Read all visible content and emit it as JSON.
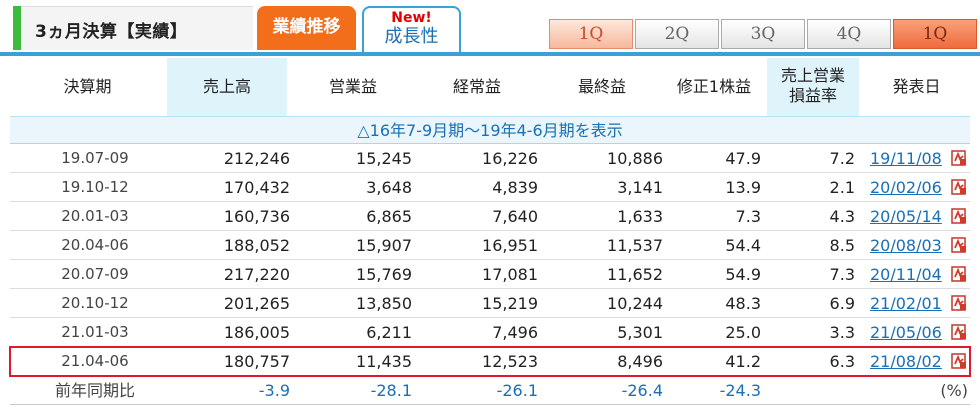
{
  "header": {
    "title": "3ヵ月決算【実績】",
    "tab_results": "業績推移",
    "tab_growth_new": "New!",
    "tab_growth_label": "成長性",
    "quarter_tabs": [
      "1Q",
      "2Q",
      "3Q",
      "4Q",
      "1Q"
    ]
  },
  "table": {
    "columns": {
      "period": "決算期",
      "sales": "売上高",
      "operating": "営業益",
      "ordinary": "経常益",
      "net": "最終益",
      "eps": "修正1株益",
      "margin_line1": "売上営業",
      "margin_line2": "損益率",
      "date": "発表日"
    },
    "range_link": "△16年7-9月期〜19年4-6月期を表示",
    "rows": [
      {
        "period": "19.07-09",
        "sales": "212,246",
        "operating": "15,245",
        "ordinary": "16,226",
        "net": "10,886",
        "eps": "47.9",
        "margin": "7.2",
        "date": "19/11/08"
      },
      {
        "period": "19.10-12",
        "sales": "170,432",
        "operating": "3,648",
        "ordinary": "4,839",
        "net": "3,141",
        "eps": "13.9",
        "margin": "2.1",
        "date": "20/02/06"
      },
      {
        "period": "20.01-03",
        "sales": "160,736",
        "operating": "6,865",
        "ordinary": "7,640",
        "net": "1,633",
        "eps": "7.3",
        "margin": "4.3",
        "date": "20/05/14"
      },
      {
        "period": "20.04-06",
        "sales": "188,052",
        "operating": "15,907",
        "ordinary": "16,951",
        "net": "11,537",
        "eps": "54.4",
        "margin": "8.5",
        "date": "20/08/03"
      },
      {
        "period": "20.07-09",
        "sales": "217,220",
        "operating": "15,769",
        "ordinary": "17,081",
        "net": "11,652",
        "eps": "54.9",
        "margin": "7.3",
        "date": "20/11/04"
      },
      {
        "period": "20.10-12",
        "sales": "201,265",
        "operating": "13,850",
        "ordinary": "15,219",
        "net": "10,244",
        "eps": "48.3",
        "margin": "6.9",
        "date": "21/02/01"
      },
      {
        "period": "21.01-03",
        "sales": "186,005",
        "operating": "6,211",
        "ordinary": "7,496",
        "net": "5,301",
        "eps": "25.0",
        "margin": "3.3",
        "date": "21/05/06"
      },
      {
        "period": "21.04-06",
        "sales": "180,757",
        "operating": "11,435",
        "ordinary": "12,523",
        "net": "8,496",
        "eps": "41.2",
        "margin": "6.3",
        "date": "21/08/02"
      }
    ],
    "yoy": {
      "label": "前年同期比",
      "sales": "-3.9",
      "operating": "-28.1",
      "ordinary": "-26.1",
      "net": "-26.4",
      "eps": "-24.3",
      "unit": "(%)"
    }
  },
  "colors": {
    "accent_blue": "#3aa0d8",
    "link_blue": "#1a6fb5",
    "tab_orange": "#f36e1b",
    "highlight_red": "#e0182d",
    "green_bar": "#3dbb3d"
  }
}
